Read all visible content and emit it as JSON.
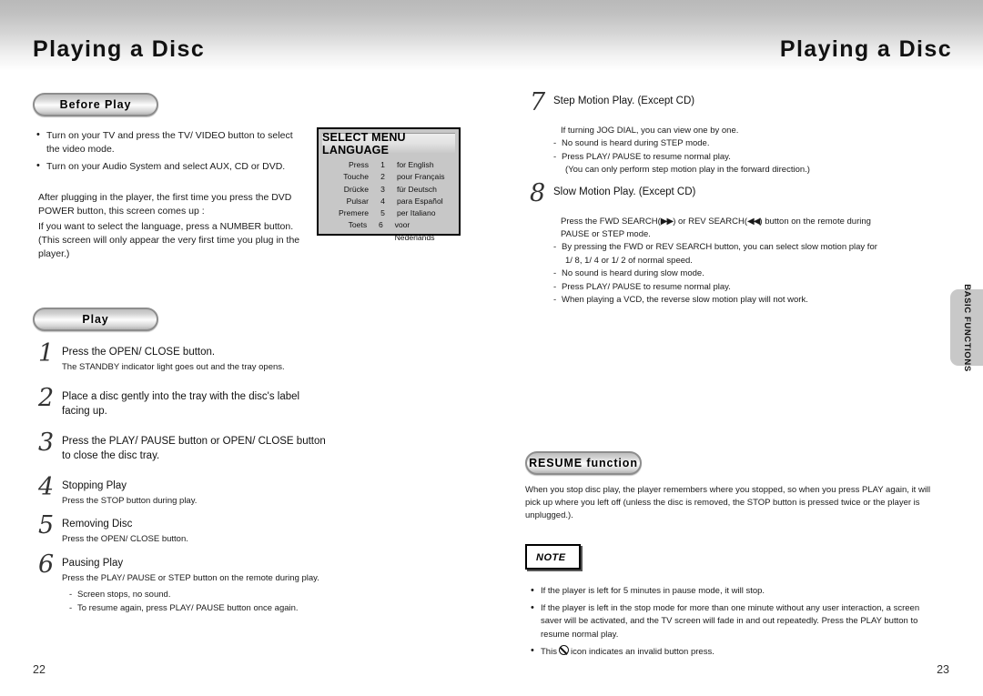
{
  "header": {
    "left_title": "Playing a Disc",
    "right_title": "Playing a Disc"
  },
  "side_tab": {
    "label": "BASIC FUNCTIONS"
  },
  "page_numbers": {
    "left": "22",
    "right": "23"
  },
  "left_page": {
    "before_play": {
      "pill_label": "Before Play",
      "bullets": [
        "Turn on your TV and press the TV/ VIDEO button to select the video mode.",
        "Turn on your Audio System and select AUX, CD or DVD."
      ],
      "paragraph_1": "After plugging in the player, the first time you press the DVD POWER button, this screen comes up :",
      "paragraph_2": "If you want to select the language, press a NUMBER button. (This screen will only appear the very first time you plug in the player.)"
    },
    "language_table": {
      "title": "SELECT MENU LANGUAGE",
      "rows": [
        {
          "word": "Press",
          "number": "1",
          "language": "for English"
        },
        {
          "word": "Touche",
          "number": "2",
          "language": "pour Français"
        },
        {
          "word": "Drücke",
          "number": "3",
          "language": "für Deutsch"
        },
        {
          "word": "Pulsar",
          "number": "4",
          "language": "para Español"
        },
        {
          "word": "Premere",
          "number": "5",
          "language": "per Italiano"
        },
        {
          "word": "Toets",
          "number": "6",
          "language": "voor Nederlands"
        }
      ]
    },
    "play": {
      "pill_label": "Play",
      "steps": [
        {
          "num": "1",
          "head": "Press the OPEN/ CLOSE button.",
          "sub": "The STANDBY indicator light goes out and the tray opens."
        },
        {
          "num": "2",
          "head": "Place a disc gently into the tray with the disc's label facing up.",
          "sub": ""
        },
        {
          "num": "3",
          "head": "Press the PLAY/ PAUSE button or OPEN/ CLOSE button to close the disc tray.",
          "sub": ""
        },
        {
          "num": "4",
          "head": "Stopping Play",
          "sub": "Press the STOP button during play."
        },
        {
          "num": "5",
          "head": "Removing Disc",
          "sub": "Press the OPEN/ CLOSE button."
        },
        {
          "num": "6",
          "head": "Pausing Play",
          "sub": "Press the PLAY/ PAUSE or STEP button on the remote during play."
        }
      ],
      "pausing_dashes": [
        "Screen stops, no sound.",
        "To resume again, press PLAY/ PAUSE button once again."
      ]
    }
  },
  "right_page": {
    "step_motion": {
      "num": "7",
      "head": "Step Motion Play. (Except CD)",
      "intro": "If turning JOG DIAL, you can view one by one.",
      "dashes": [
        "No sound is heard during STEP mode.",
        "Press PLAY/ PAUSE to resume normal play."
      ],
      "dash_cont": "(You can only perform step motion play in the forward direction.)"
    },
    "slow_motion": {
      "num": "8",
      "head": "Slow Motion Play. (Except CD)",
      "intro_a": "Press the FWD SEARCH(",
      "fwd_glyph": "▶▶",
      "intro_b": ") or REV SEARCH(",
      "rev_glyph": "◀◀",
      "intro_c": ") button on the remote during",
      "intro_d": "PAUSE or STEP mode.",
      "dashes": [
        "By pressing the FWD or REV SEARCH button, you can select slow motion play for",
        "No sound is heard during slow mode.",
        "Press PLAY/ PAUSE to resume normal play.",
        "When playing a VCD, the reverse slow motion play will not work."
      ],
      "dash_cont": "1/ 8, 1/ 4 or 1/ 2 of normal speed."
    },
    "resume": {
      "pill_label": "RESUME function",
      "paragraph_line_1": "When you stop disc play, the player remembers where you stopped, so when you press PLAY again, it will pick up",
      "paragraph_line_2": "where you left off (unless the disc is removed, the STOP button is pressed twice or the player is unplugged.)."
    },
    "note": {
      "label": "NOTE",
      "bullets": [
        "If the player is left for 5 minutes in pause mode, it will stop.",
        "If the player is left in the stop mode for more than one minute without any user interaction, a screen saver will be activated, and the TV screen will fade in and out repeatedly. Press the PLAY button to resume normal play."
      ],
      "icon_bullet_prefix": "This",
      "icon_name": "invalid-press-icon",
      "icon_bullet_suffix": "icon indicates an invalid button press."
    }
  }
}
